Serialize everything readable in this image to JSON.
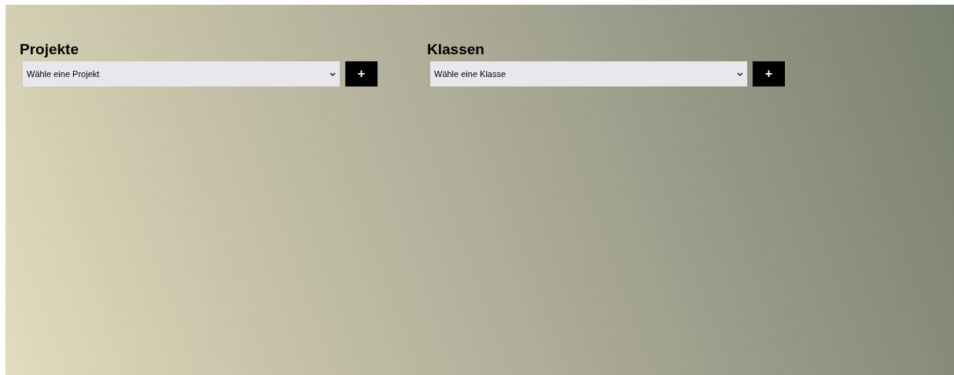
{
  "sections": [
    {
      "heading": "Projekte",
      "select": {
        "placeholder": "Wähle eine Projekt"
      },
      "add_button": "+"
    },
    {
      "heading": "Klassen",
      "select": {
        "placeholder": "Wähle eine Klasse"
      },
      "add_button": "+"
    }
  ]
}
